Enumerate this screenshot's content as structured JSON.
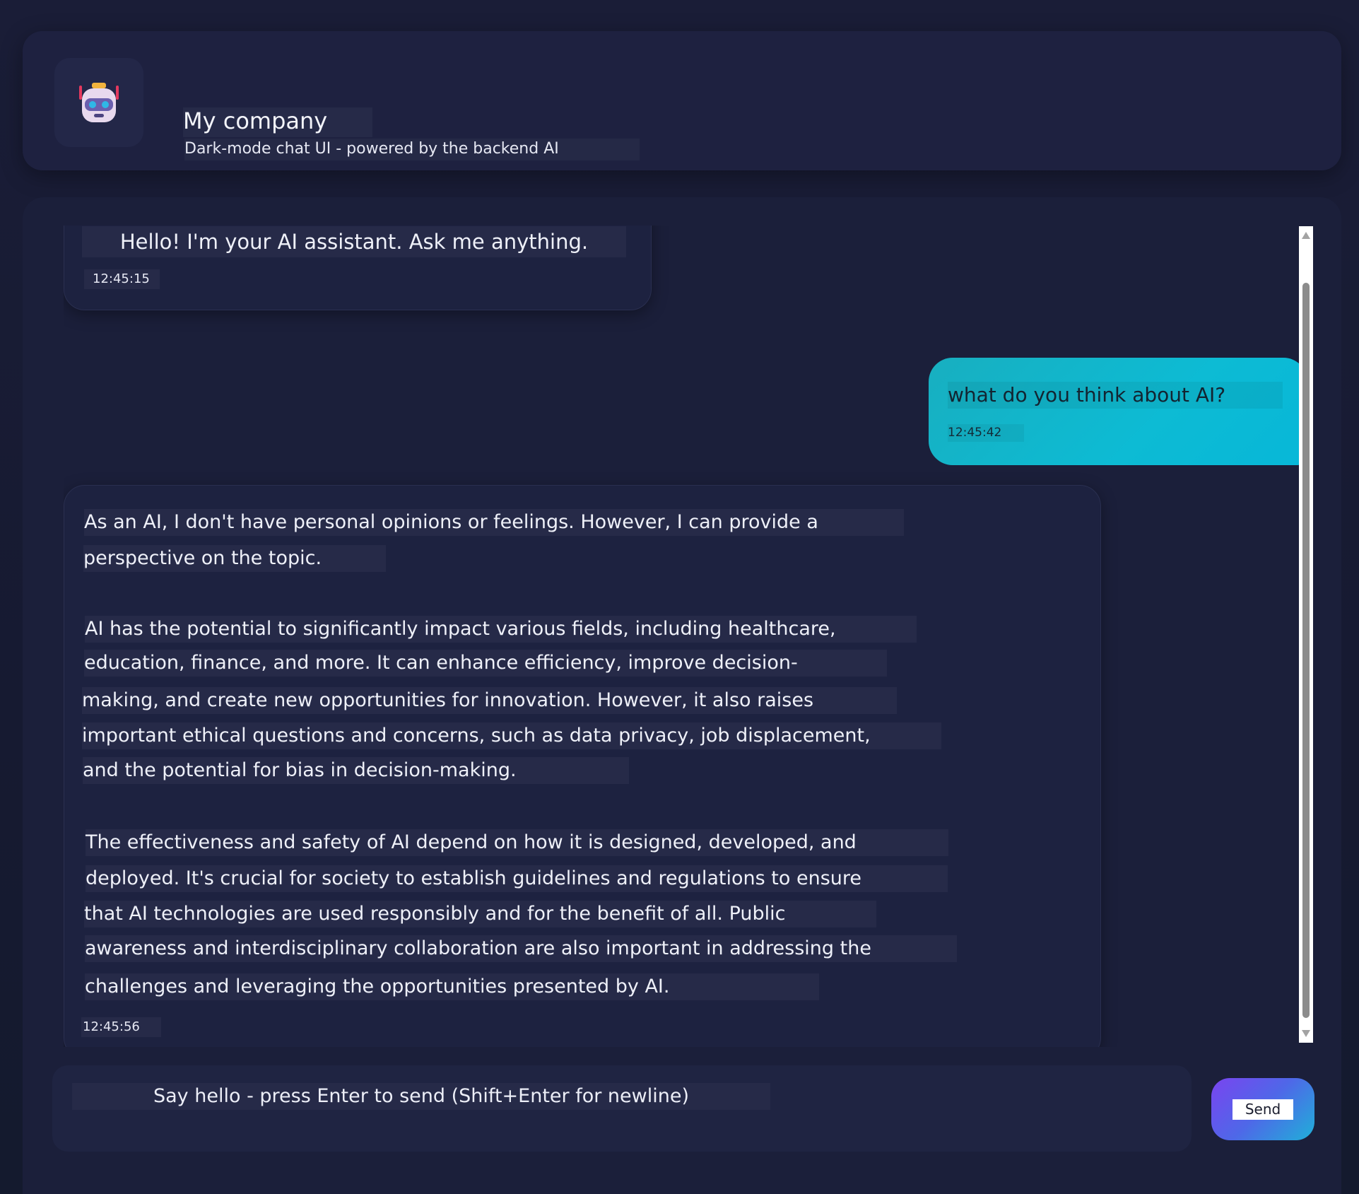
{
  "header": {
    "title": "My company",
    "subtitle": "Dark-mode chat UI - powered by the backend AI",
    "avatar_icon": "robot-icon"
  },
  "messages": [
    {
      "role": "assistant",
      "lines": [
        "Hello! I'm your AI assistant. Ask me anything."
      ],
      "time": "12:45:15"
    },
    {
      "role": "user",
      "lines": [
        "what do you think about AI?"
      ],
      "time": "12:45:42"
    },
    {
      "role": "assistant",
      "lines": [
        "As an AI, I don't have personal opinions or feelings. However, I can provide a",
        "perspective on the topic.",
        "AI has the potential to significantly impact various fields, including healthcare,",
        "education, finance, and more. It can enhance efficiency, improve decision-",
        "making, and create new opportunities for innovation. However, it also raises",
        "important ethical questions and concerns, such as data privacy, job displacement,",
        "and the potential for bias in decision-making.",
        "The effectiveness and safety of AI depend on how it is designed, developed, and",
        "deployed. It's crucial for society to establish guidelines and regulations to ensure",
        "that AI technologies are used responsibly and for the benefit of all. Public",
        "awareness and interdisciplinary collaboration are also important in addressing the",
        "challenges and leveraging the opportunities presented by AI."
      ],
      "time": "12:45:56"
    }
  ],
  "composer": {
    "placeholder": "Say hello - press Enter to send (Shift+Enter for newline)",
    "send_label": "Send"
  },
  "colors": {
    "background": "#181b33",
    "panel": "#1b1f3a",
    "user_bubble": "#0dbbd4",
    "send_gradient_start": "#7a44f0",
    "send_gradient_end": "#1fb0d8"
  }
}
